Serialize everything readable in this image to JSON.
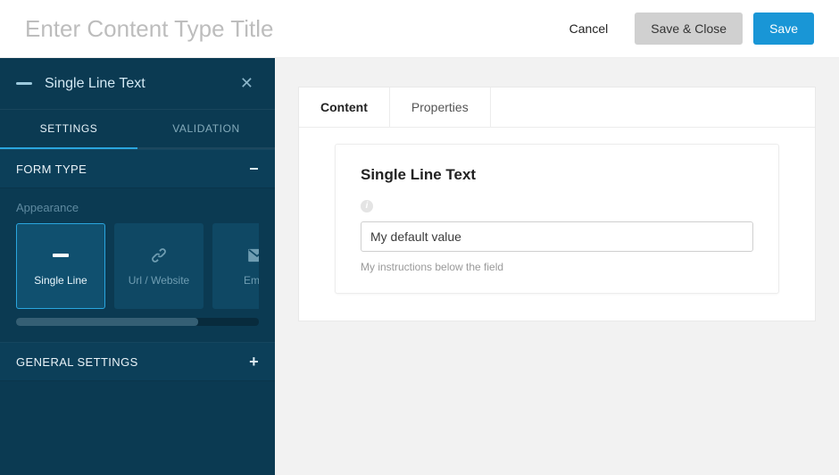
{
  "header": {
    "title_placeholder": "Enter Content Type Title",
    "title_value": "",
    "actions": {
      "cancel": "Cancel",
      "save_close": "Save & Close",
      "save": "Save"
    }
  },
  "sidebar": {
    "field_name": "Single Line Text",
    "tabs": [
      {
        "label": "SETTINGS",
        "active": true
      },
      {
        "label": "VALIDATION",
        "active": false
      }
    ],
    "sections": {
      "form_type": {
        "title": "FORM TYPE",
        "collapsed": false,
        "collapse_glyph": "−",
        "appearance_label": "Appearance",
        "tiles": [
          {
            "label": "Single Line",
            "active": true,
            "icon": "single-line"
          },
          {
            "label": "Url / Website",
            "active": false,
            "icon": "link"
          },
          {
            "label": "Email",
            "active": false,
            "icon": "email"
          }
        ]
      },
      "general": {
        "title": "GENERAL SETTINGS",
        "collapsed": true,
        "collapse_glyph": "+"
      }
    },
    "scroll": {
      "thumb_pct": 75
    }
  },
  "preview": {
    "tabs": [
      {
        "label": "Content",
        "active": true
      },
      {
        "label": "Properties",
        "active": false
      }
    ],
    "card": {
      "title": "Single Line Text",
      "info_glyph": "i",
      "field_value": "My default value",
      "instructions": "My instructions below the field"
    }
  }
}
